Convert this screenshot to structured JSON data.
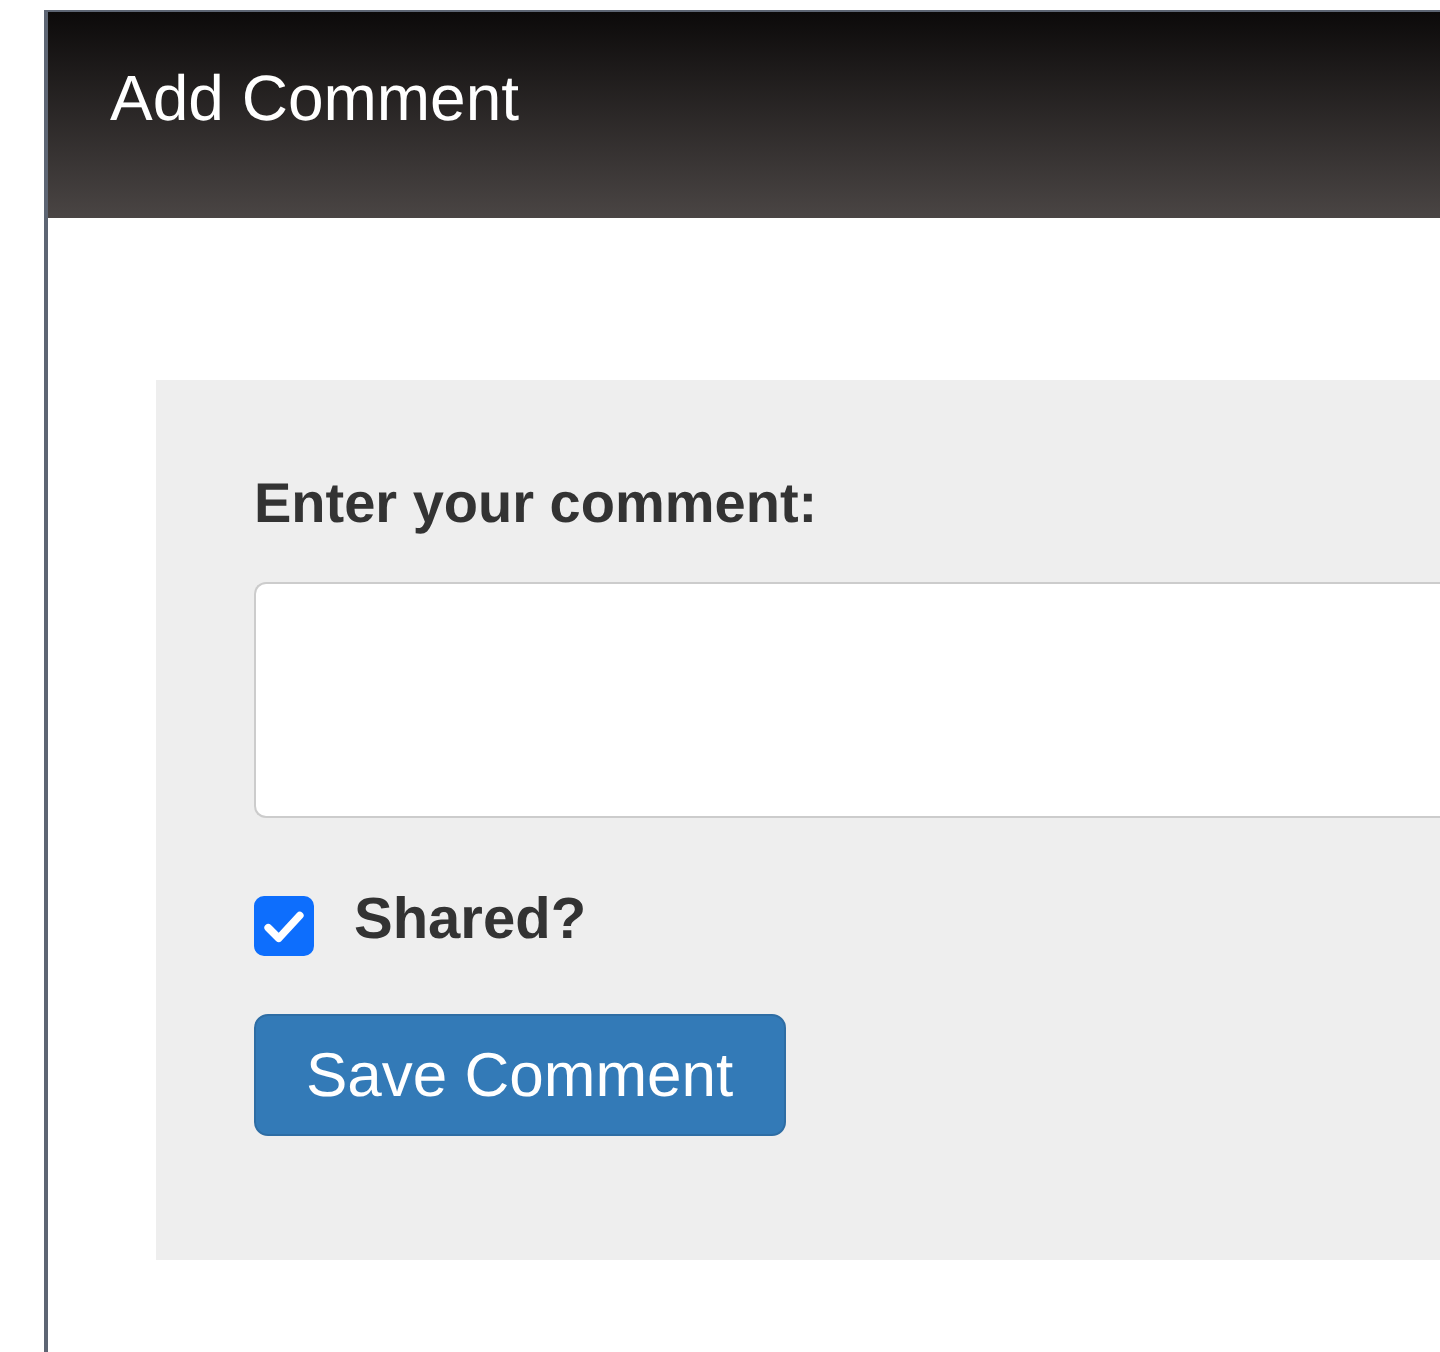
{
  "window": {
    "title": "Add Comment"
  },
  "form": {
    "label": "Enter your comment:",
    "shared": {
      "label": "Shared?",
      "checked": true
    },
    "button": "Save Comment"
  }
}
